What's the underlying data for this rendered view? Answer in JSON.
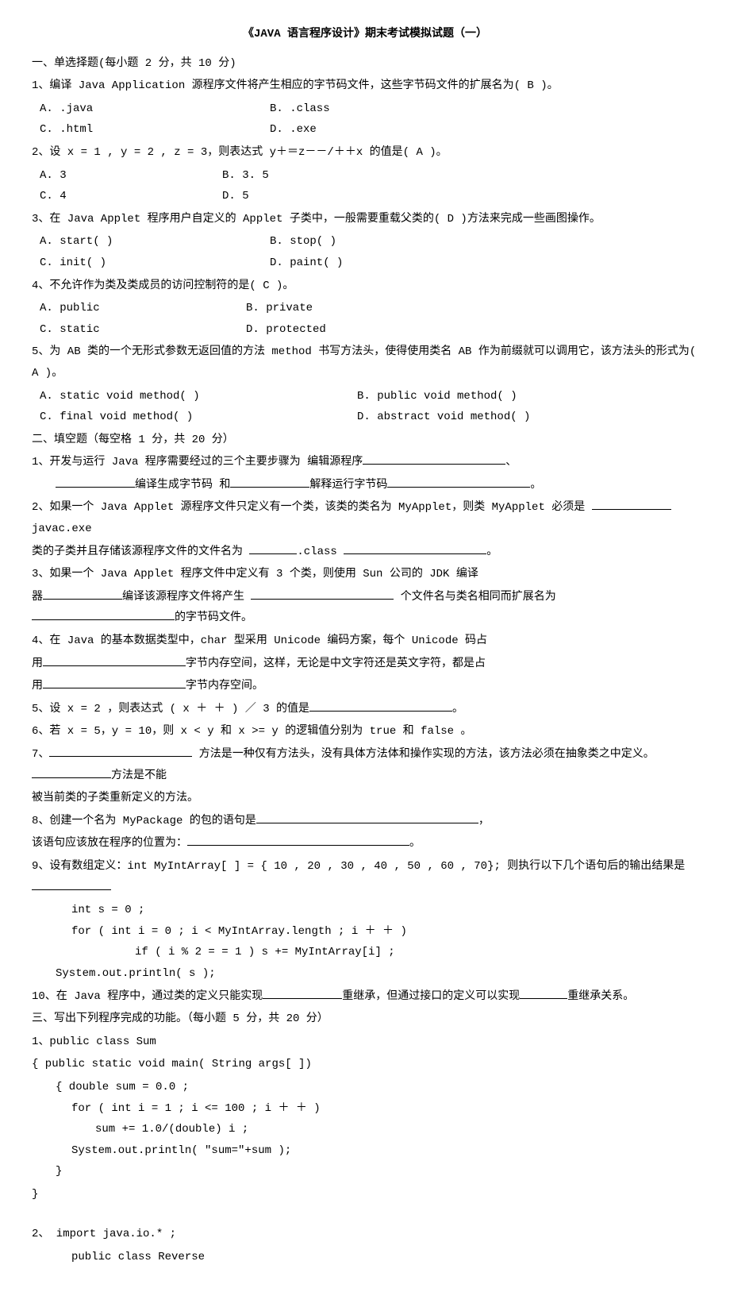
{
  "title": "《JAVA 语言程序设计》期末考试模拟试题（一）",
  "section1": {
    "header": "一、单选择题(每小题 2 分，共 10 分)",
    "q1": {
      "text": "1、编译 Java  Application 源程序文件将产生相应的字节码文件，这些字节码文件的扩展名为(  B   )。",
      "optA": "A.    .java",
      "optB": "B.    .class",
      "optC": "C.    .html",
      "optD": "D.    .exe"
    },
    "q2": {
      "text": "2、设 x = 1 ,  y = 2 ,  z = 3，则表达式  y＋＝z－－/＋＋x  的值是(   A  )。",
      "optA": "A.    3",
      "optB": "B.    3. 5",
      "optC": "C.    4",
      "optD": "D.    5"
    },
    "q3": {
      "text": "3、在 Java  Applet 程序用户自定义的 Applet 子类中，一般需要重载父类的(  D   )方法来完成一些画图操作。",
      "optA": "A.    start( )",
      "optB": "B.    stop( )",
      "optC": "C.    init( )",
      "optD": "D.    paint( )"
    },
    "q4": {
      "text": "4、不允许作为类及类成员的访问控制符的是(    C  )。",
      "optA": "A.    public",
      "optB": "B.    private",
      "optC": "C.    static",
      "optD": "D.    protected"
    },
    "q5": {
      "text": "5、为 AB 类的一个无形式参数无返回值的方法 method 书写方法头，使得使用类名 AB 作为前缀就可以调用它，该方法头的形式为(  A   )。",
      "optA": "A.  static  void  method( )",
      "optB": "B. public  void  method( )",
      "optC": "C. final  void  method( )",
      "optD": "D. abstract  void  method( )"
    }
  },
  "section2": {
    "header": "二、填空题（每空格 1 分，共 20 分）",
    "q1_1": "1、开发与运行 Java 程序需要经过的三个主要步骤为  编辑源程序",
    "q1_2": "、",
    "q1_3": "编译生成字节码  和",
    "q1_4": "解释运行字节码",
    "q1_5": "。",
    "q2_1": "2、如果一个 Java  Applet 源程序文件只定义有一个类，该类的类名为 MyApplet，则类 MyApplet 必须是 ",
    "q2_2": " javac.exe",
    "q2_3": "类的子类并且存储该源程序文件的文件名为 ",
    "q2_4": ".class ",
    "q2_5": "。",
    "q3_1": "3、如果一个 Java  Applet 程序文件中定义有 3 个类，则使用 Sun 公司的 JDK 编译",
    "q3_2": "器",
    "q3_3": "编译该源程序文件将产生 ",
    "q3_4": " 个文件名与类名相同而扩展名为",
    "q3_5": "的字节码文件。",
    "q4_1": "4、在 Java 的基本数据类型中，char 型采用 Unicode 编码方案，每个 Unicode 码占",
    "q4_2": "用",
    "q4_3": "字节内存空间，这样，无论是中文字符还是英文字符，都是占",
    "q4_4": "用",
    "q4_5": "字节内存空间。",
    "q5_1": "5、设 x = 2 ，则表达式 ( x ＋ ＋ ) ／ 3 的值是",
    "q5_2": "。",
    "q6_1": "6、若 x = 5，y = 10，则 x < y 和 x >= y 的逻辑值分别为   true        和     false   。",
    "q7_1": "7、",
    "q7_2": " 方法是一种仅有方法头，没有具体方法体和操作实现的方法，该方法必须在抽象类之中定义。",
    "q7_3": "方法是不能",
    "q7_4": "被当前类的子类重新定义的方法。",
    "q8_1": "8、创建一个名为 MyPackage 的包的语句是",
    "q8_2": "，",
    "q8_3": "该语句应该放在程序的位置为：",
    "q8_4": "。",
    "q9_1": "9、设有数组定义：int   MyIntArray[ ] = { 10 , 20 , 30 , 40 , 50 , 60 , 70};  则执行以下几个语句后的输出结果是  ",
    "q9_line1": "int  s = 0 ;",
    "q9_line2": "for  ( int  i = 0 ; i < MyIntArray.length ; i ＋ ＋ )",
    "q9_line3": "if  ( i % 2 = = 1 )    s += MyIntArray[i] ;",
    "q9_line4": "System.out.println( s );",
    "q10_1": "10、在 Java 程序中，通过类的定义只能实现",
    "q10_2": "重继承，但通过接口的定义可以实现",
    "q10_3": "重继承关系。"
  },
  "section3": {
    "header": "三、写出下列程序完成的功能。（每小题 5 分，共 20 分）",
    "p1_l1": "1、public  class   Sum",
    "p1_l2": "{  public  static  void   main( String  args[ ])",
    "p1_l3": "{   double    sum = 0.0 ;",
    "p1_l4": "for ( int  i = 1 ; i <= 100 ; i ＋ ＋ )",
    "p1_l5": "sum += 1.0/(double) i ;",
    "p1_l6": "System.out.println( \"sum=\"+sum );",
    "p1_l7": "}",
    "p1_l8": "}",
    "p2_l1": "2、 import   java.io.* ;",
    "p2_l2": "public  class  Reverse"
  }
}
